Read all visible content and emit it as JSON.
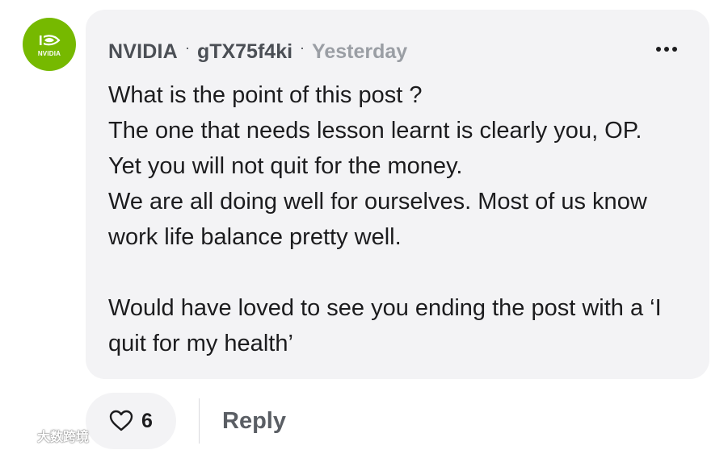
{
  "comment": {
    "avatar": {
      "brand": "NVIDIA",
      "color": "#76b900"
    },
    "author": "NVIDIA",
    "handle": "gTX75f4ki",
    "separator": "·",
    "time": "Yesterday",
    "more_icon": "more-horizontal-icon",
    "body": {
      "line1": "What is the point of this post ?",
      "line2": "The one that needs lesson learnt is clearly you, OP.",
      "line3": "Yet you will not quit for the money.",
      "line4": "We are all doing well for ourselves. Most of us know work life balance pretty well.",
      "line5": "Would have loved to see you ending the post with a ‘I quit for my health’"
    }
  },
  "actions": {
    "like_icon": "heart-icon",
    "like_count": "6",
    "reply_label": "Reply"
  },
  "watermark": {
    "text": "大数跨境"
  },
  "colors": {
    "bubble_bg": "#f3f3f5",
    "text": "#1c1c1e",
    "muted": "#9a9ea4"
  }
}
